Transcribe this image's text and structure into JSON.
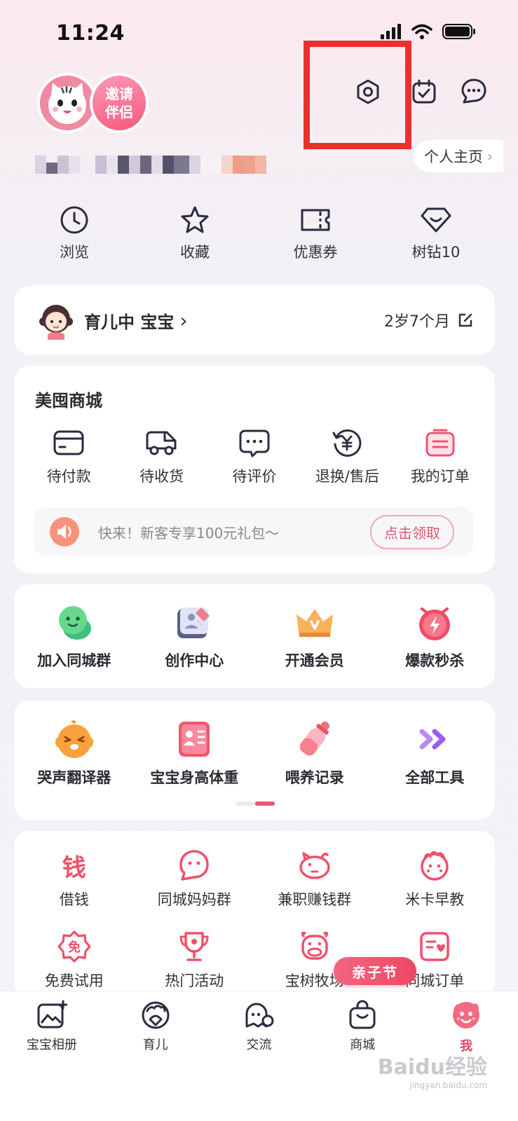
{
  "status_bar": {
    "time": "11:24"
  },
  "header": {
    "invite_line1": "邀请",
    "invite_line2": "伴侣",
    "profile_link": "个人主页",
    "icons": [
      "settings-icon",
      "calendar-check-icon",
      "message-icon"
    ]
  },
  "quick_links": [
    {
      "label": "浏览",
      "icon": "clock-icon"
    },
    {
      "label": "收藏",
      "icon": "star-icon"
    },
    {
      "label": "优惠券",
      "icon": "coupon-icon"
    },
    {
      "label": "树钻10",
      "icon": "diamond-icon"
    }
  ],
  "baby": {
    "status": "育儿中 宝宝",
    "age": "2岁7个月"
  },
  "mall": {
    "title": "美囤商城",
    "orders": [
      {
        "label": "待付款",
        "icon": "card-icon"
      },
      {
        "label": "待收货",
        "icon": "truck-icon"
      },
      {
        "label": "待评价",
        "icon": "comment-icon"
      },
      {
        "label": "退换/售后",
        "icon": "refund-icon"
      },
      {
        "label": "我的订单",
        "icon": "order-list-icon"
      }
    ],
    "promo_text": "快来！新客专享100元礼包～",
    "promo_button": "点击领取"
  },
  "features": [
    {
      "label": "加入同城群",
      "icon": "group-chat-icon"
    },
    {
      "label": "创作中心",
      "icon": "create-icon"
    },
    {
      "label": "开通会员",
      "icon": "crown-icon"
    },
    {
      "label": "爆款秒杀",
      "icon": "flash-sale-icon"
    }
  ],
  "tools": [
    {
      "label": "哭声翻译器",
      "icon": "cry-translator-icon"
    },
    {
      "label": "宝宝身高体重",
      "icon": "height-weight-icon"
    },
    {
      "label": "喂养记录",
      "icon": "bottle-icon"
    },
    {
      "label": "全部工具",
      "icon": "double-arrow-icon"
    }
  ],
  "services": [
    {
      "label": "借钱",
      "icon": "money-icon"
    },
    {
      "label": "同城妈妈群",
      "icon": "mom-group-icon"
    },
    {
      "label": "兼职赚钱群",
      "icon": "piggy-bank-icon"
    },
    {
      "label": "米卡早教",
      "icon": "baby-face-icon"
    },
    {
      "label": "免费试用",
      "icon": "free-badge-icon"
    },
    {
      "label": "热门活动",
      "icon": "trophy-icon"
    },
    {
      "label": "宝树牧场",
      "icon": "cow-icon"
    },
    {
      "label": "同城订单",
      "icon": "local-order-icon"
    }
  ],
  "festival_badge": "亲子节",
  "tabs": [
    {
      "label": "宝宝相册",
      "icon": "album-icon"
    },
    {
      "label": "育儿",
      "icon": "parenting-icon"
    },
    {
      "label": "交流",
      "icon": "chat-ghost-icon"
    },
    {
      "label": "商城",
      "icon": "shopping-bag-icon"
    },
    {
      "label": "我",
      "icon": "me-icon",
      "active": true
    }
  ],
  "colors": {
    "accent": "#e64266",
    "highlight_box": "#ea2f2f",
    "card": "#ffffff"
  },
  "watermark": {
    "brand": "Baidu经验",
    "url": "jingyan.baidu.com"
  }
}
